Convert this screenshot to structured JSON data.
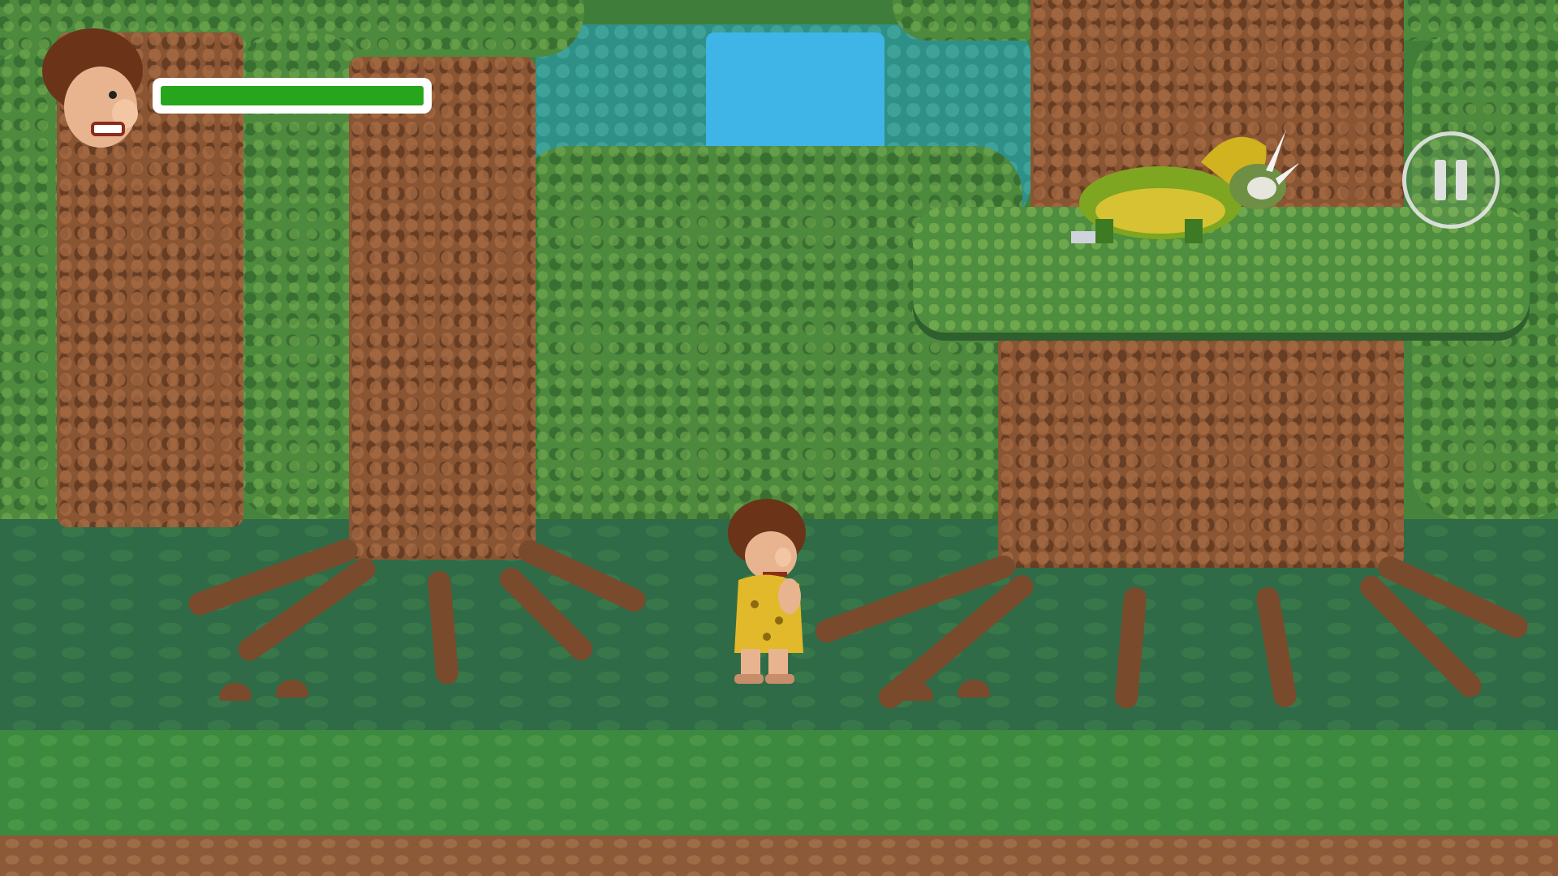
{
  "hud": {
    "player_portrait": "caveman-face-portrait",
    "health": {
      "fraction": 1.0,
      "fill_color": "#27a61d",
      "frame_color": "#ffffff"
    },
    "pause_button": {
      "icon": "pause-icon"
    }
  },
  "scene": {
    "setting": "prehistoric-forest",
    "player": {
      "character": "caveman",
      "outfit_color": "#e2b92a"
    },
    "enemy": {
      "character": "triceratops",
      "body_color": "#7fa620"
    }
  },
  "palette": {
    "foliage": "#4d8a3e",
    "trunk": "#8a5533",
    "sky": "#3fb4e6",
    "grass": "#2f6b47",
    "dirt": "#8c5a38"
  }
}
